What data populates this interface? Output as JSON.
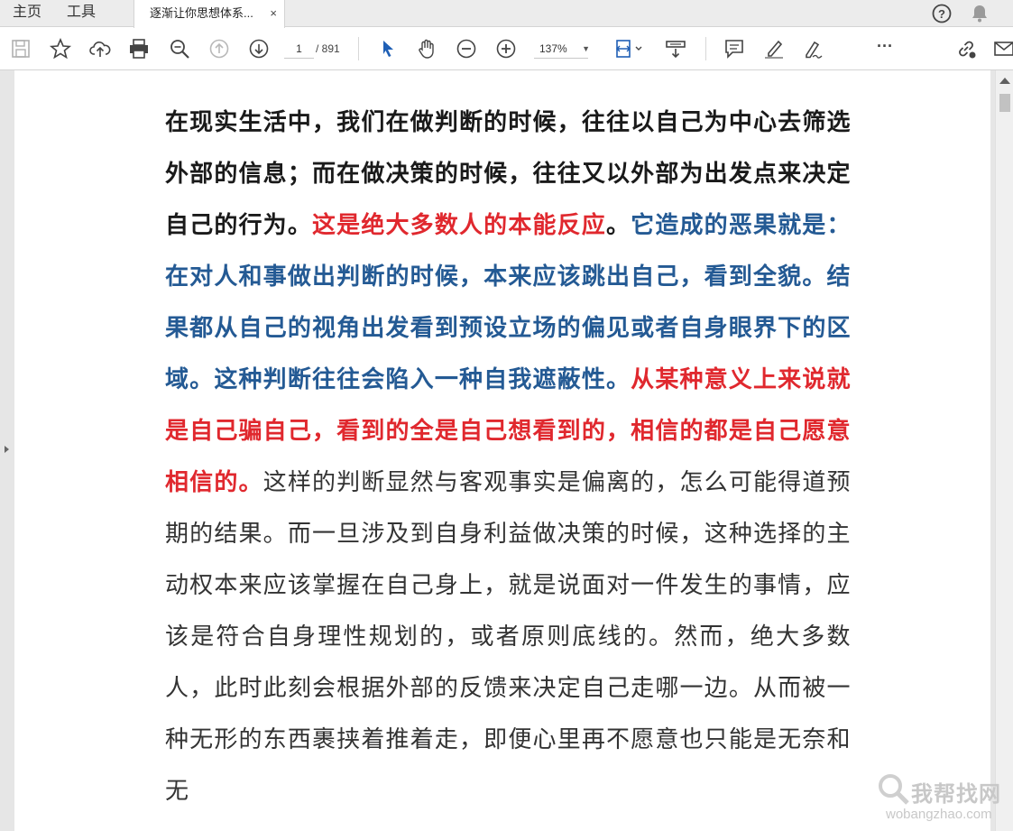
{
  "menu": {
    "home": "主页",
    "tools": "工具"
  },
  "tab": {
    "title": "逐渐让你思想体系...",
    "close": "×"
  },
  "toolbar": {
    "page_current": "1",
    "page_total": "/ 891",
    "zoom": "137%",
    "more": "···",
    "icons": [
      "save-icon",
      "bookmark-star-icon",
      "upload-cloud-icon",
      "print-icon",
      "zoom-search-icon",
      "page-up-icon",
      "page-down-icon",
      "select-cursor-icon",
      "hand-pan-icon",
      "zoom-out-icon",
      "zoom-in-icon",
      "fit-page-icon",
      "scroll-mode-icon",
      "comment-icon",
      "highlight-pen-icon",
      "sign-icon",
      "more-icon",
      "share-link-icon",
      "email-icon"
    ]
  },
  "top_right": {
    "icons": [
      "help-icon",
      "bell-icon"
    ]
  },
  "document": {
    "segments": [
      {
        "style": "bold",
        "text": "在现实生活中，我们在做判断的时候，往往以自己为中心去筛选外部的信息；而在做决策的时候，往往又以外部为出发点来决定自己的行为。"
      },
      {
        "style": "red",
        "text": "这是绝大多数人的本能反应"
      },
      {
        "style": "bold",
        "text": "。"
      },
      {
        "style": "blue",
        "text": "它造成的恶果就是：在对人和事做出判断的时候，本来应该跳出自己，看到全貌。结果都从自己的视角出发看到预设立场的偏见或者自身眼界下的区域。这种判断往往会陷入一种自我遮蔽性。"
      },
      {
        "style": "red",
        "text": "从某种意义上来说就是自己骗自己，看到的全是自己想看到的，相信的都是自己愿意相信的。"
      },
      {
        "style": "normal",
        "text": "这样的判断显然与客观事实是偏离的，怎么可能得道预期的结果。而一旦涉及到自身利益做决策的时候，这种选择的主动权本来应该掌握在自己身上，就是说面对一件发生的事情，应该是符合自身理性规划的，或者原则底线的。然而，绝大多数人，此时此刻会根据外部的反馈来决定自己走哪一边。从而被一种无形的东西裹挟着推着走，即便心里再不愿意也只能是无奈和无"
      }
    ]
  },
  "watermark": {
    "brand": "我帮找网",
    "url": "wobangzhao.com"
  },
  "colors": {
    "red": "#e0282e",
    "blue": "#245a94",
    "text": "#333333",
    "accent_cursor": "#1f5fb5"
  }
}
